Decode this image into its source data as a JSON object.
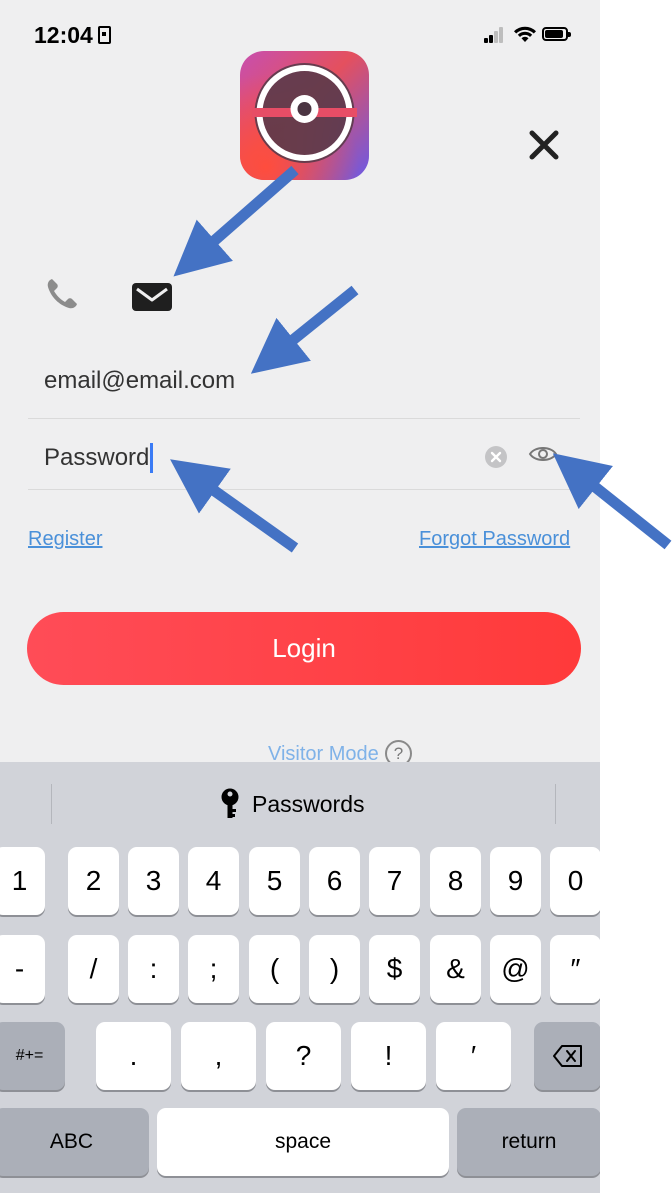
{
  "status_bar": {
    "time": "12:04"
  },
  "login_form": {
    "email_value": "email@email.com",
    "password_placeholder": "Password",
    "register_label": "Register",
    "forgot_password_label": "Forgot Password",
    "login_label": "Login",
    "visitor_mode_label": "Visitor Mode",
    "help_label": "?"
  },
  "keyboard": {
    "suggestion_label": "Passwords",
    "row1": [
      "1",
      "2",
      "3",
      "4",
      "5",
      "6",
      "7",
      "8",
      "9",
      "0"
    ],
    "row2": [
      "-",
      "/",
      ":",
      ";",
      "(",
      ")",
      "$",
      "&",
      "@",
      "″"
    ],
    "row3": {
      "symbols": "#+=",
      "keys": [
        ".",
        ",",
        "?",
        "!",
        "′"
      ]
    },
    "row4": {
      "abc": "ABC",
      "space": "space",
      "return": "return"
    }
  },
  "colors": {
    "accent_red": "#ff3a3a",
    "link_blue": "#4a90d9",
    "annotation_arrow": "#4472c4"
  },
  "icons": [
    "phone-icon",
    "mail-icon",
    "close-icon",
    "clear-icon",
    "eye-icon",
    "key-icon",
    "backspace-icon",
    "help-icon"
  ]
}
